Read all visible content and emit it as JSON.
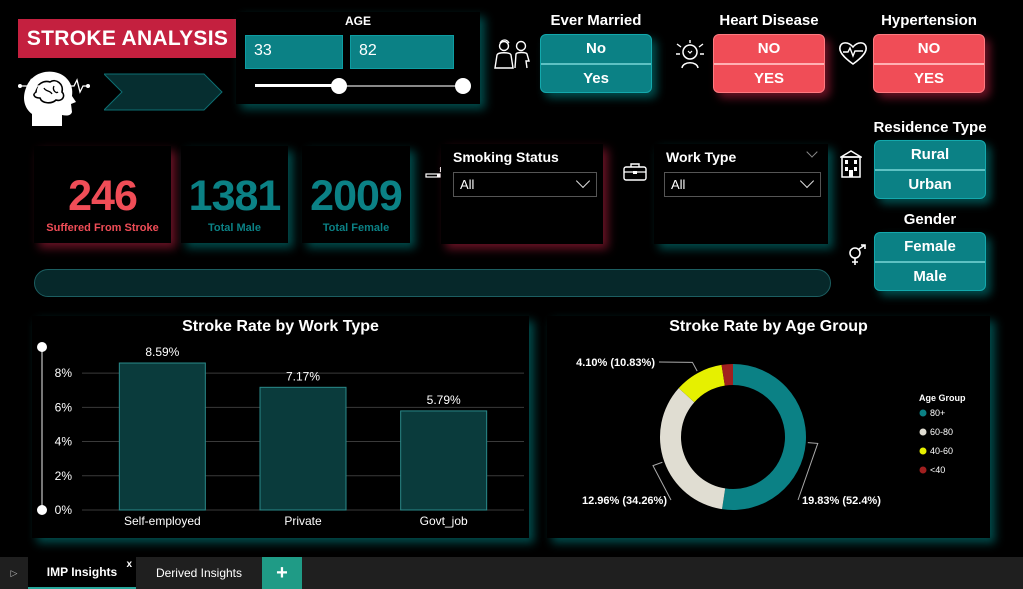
{
  "title": "STROKE ANALYSIS",
  "age_slicer": {
    "label": "AGE",
    "min_value": "33",
    "max_value": "82",
    "range": [
      33,
      82
    ],
    "bounds": [
      0,
      82
    ]
  },
  "ever_married": {
    "title": "Ever Married",
    "options": [
      "No",
      "Yes"
    ]
  },
  "heart_disease": {
    "title": "Heart Disease",
    "options": [
      "NO",
      "YES"
    ]
  },
  "hypertension": {
    "title": "Hypertension",
    "options": [
      "NO",
      "YES"
    ]
  },
  "residence_type": {
    "title": "Residence Type",
    "options": [
      "Rural",
      "Urban"
    ]
  },
  "gender": {
    "title": "Gender",
    "options": [
      "Female",
      "Male"
    ]
  },
  "kpis": [
    {
      "value": "246",
      "label": "Suffered From Stroke",
      "color": "#f04d57"
    },
    {
      "value": "1381",
      "label": "Total Male",
      "color": "#0b8185"
    },
    {
      "value": "2009",
      "label": "Total Female",
      "color": "#0b8185"
    }
  ],
  "smoking_status": {
    "title": "Smoking Status",
    "value": "All"
  },
  "work_type": {
    "title": "Work Type",
    "value": "All"
  },
  "colors": {
    "teal": "#0b8185",
    "red": "#f04d57",
    "title_bg": "#c4203f",
    "bar_fill": "#0a3b3c",
    "bar_stroke": "#2a8a8a"
  },
  "chart_data": [
    {
      "type": "bar",
      "title": "Stroke Rate by Work Type",
      "categories": [
        "Self-employed",
        "Private",
        "Govt_job"
      ],
      "values": [
        8.59,
        7.17,
        5.79
      ],
      "data_labels": [
        "8.59%",
        "7.17%",
        "5.79%"
      ],
      "y_ticks": [
        "0%",
        "2%",
        "4%",
        "6%",
        "8%"
      ],
      "ylim": [
        0,
        9
      ],
      "grid": true
    },
    {
      "type": "pie",
      "title": "Stroke Rate by Age Group",
      "legend_title": "Age Group",
      "legend_placement": "right",
      "slices": [
        {
          "name": "80+",
          "value": 19.83,
          "share": 52.4,
          "label": "19.83% (52.4%)",
          "color": "#0b8185"
        },
        {
          "name": "60-80",
          "value": 12.96,
          "share": 34.26,
          "label": "12.96% (34.26%)",
          "color": "#e0ddd2"
        },
        {
          "name": "40-60",
          "value": 4.1,
          "share": 10.83,
          "label": "4.10% (10.83%)",
          "color": "#e6f000"
        },
        {
          "name": "<40",
          "value": 0.95,
          "share": 2.51,
          "label": "",
          "color": "#a01f1f"
        }
      ]
    }
  ],
  "tabs": [
    {
      "label": "IMP Insights",
      "close": "x"
    },
    {
      "label": "Derived Insights"
    },
    {
      "label": "+"
    }
  ]
}
